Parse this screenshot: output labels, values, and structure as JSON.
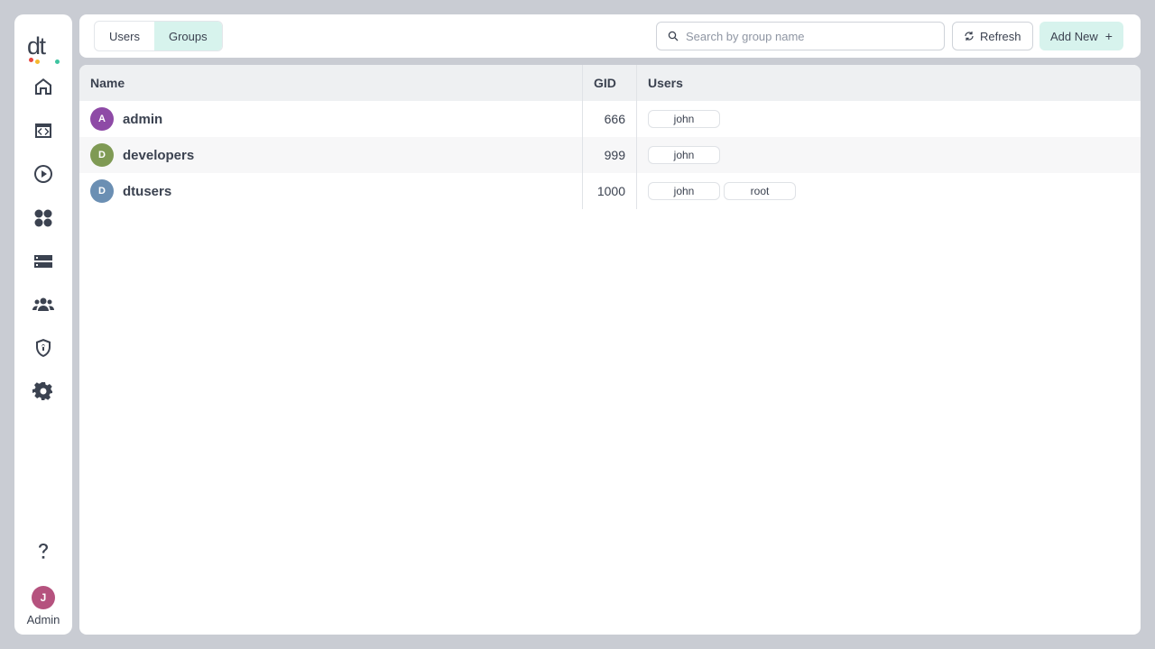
{
  "sidebar": {
    "logo_text": "dt",
    "nav_icons": [
      "home-icon",
      "code-window-icon",
      "play-circle-icon",
      "apps-icon",
      "server-icon",
      "users-icon",
      "shield-icon",
      "gear-icon"
    ],
    "help_icon": "question-icon",
    "user_initial": "J",
    "user_label": "Admin",
    "colors": {
      "avatar": "#b5527e",
      "logo_dots": [
        "#e8483f",
        "#f5b82e",
        "#3ec4a0"
      ]
    }
  },
  "toolbar": {
    "tabs": [
      {
        "label": "Users",
        "active": false
      },
      {
        "label": "Groups",
        "active": true
      }
    ],
    "search_placeholder": "Search by group name",
    "refresh_label": "Refresh",
    "add_label": "Add New",
    "accent_color": "#d7f3ed"
  },
  "table": {
    "headers": {
      "name": "Name",
      "gid": "GID",
      "users": "Users"
    },
    "rows": [
      {
        "initial": "A",
        "name": "admin",
        "gid": "666",
        "users": [
          "john"
        ],
        "avatar_color": "#8e4aa6"
      },
      {
        "initial": "D",
        "name": "developers",
        "gid": "999",
        "users": [
          "john"
        ],
        "avatar_color": "#7f9a54"
      },
      {
        "initial": "D",
        "name": "dtusers",
        "gid": "1000",
        "users": [
          "john",
          "root"
        ],
        "avatar_color": "#6b8fb3"
      }
    ]
  }
}
